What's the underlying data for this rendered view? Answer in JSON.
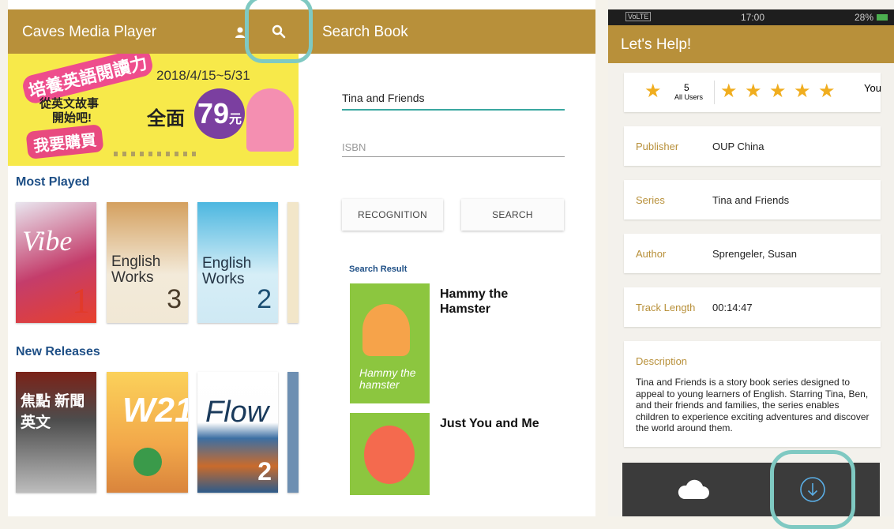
{
  "left": {
    "app_title": "Caves Media Player",
    "banner": {
      "title_cn": "培養英語閱讀力",
      "date": "2018/4/15~5/31",
      "slogan_1": "從英文故事",
      "slogan_2": "開始吧!",
      "offer": "全面",
      "price": "79",
      "price_unit": "元",
      "buy": "我要購買"
    },
    "most_played": {
      "heading": "Most Played",
      "books": [
        "Vibe",
        "English Works",
        "English Works"
      ]
    },
    "new_releases": {
      "heading": "New Releases",
      "books": [
        "焦點 新聞英文",
        "W21",
        "Flow"
      ]
    }
  },
  "middle": {
    "header_title": "Search Book",
    "title_value": "Tina and Friends",
    "isbn_placeholder": "ISBN",
    "recognition_label": "RECOGNITION",
    "search_label": "SEARCH",
    "result_heading": "Search Result",
    "results": [
      {
        "title": "Hammy the Hamster",
        "cover_text": "Hammy the hamster"
      },
      {
        "title": "Just You and Me"
      }
    ]
  },
  "right": {
    "status": {
      "carrier": "VoLTE",
      "time": "17:00",
      "battery": "28%"
    },
    "header_title": "Let's Help!",
    "rating": {
      "average": "5",
      "average_label": "All Users",
      "user_label": "You",
      "user_stars": 5
    },
    "details": [
      {
        "label": "Publisher",
        "value": "OUP China"
      },
      {
        "label": "Series",
        "value": "Tina and Friends"
      },
      {
        "label": "Author",
        "value": "Sprengeler, Susan"
      },
      {
        "label": "Track Length",
        "value": "00:14:47"
      }
    ],
    "description_label": "Description",
    "description": "Tina and Friends is a story book series designed to appeal to young learners of English. Starring Tina, Ben, and their friends and families, the series enables children to experience exciting adventures and discover the world around them."
  }
}
